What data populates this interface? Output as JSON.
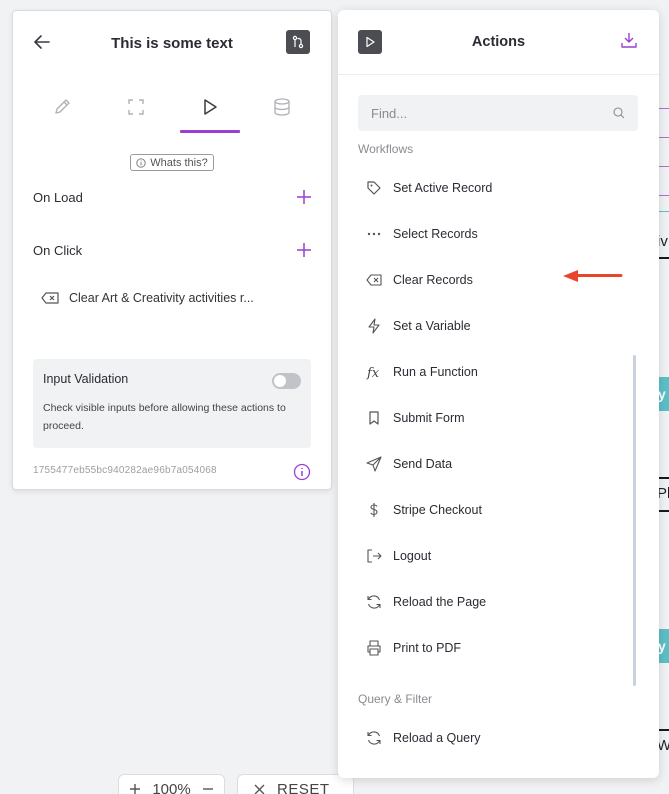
{
  "props": {
    "title": "This is some text",
    "whats_this": "Whats this?",
    "on_load": "On Load",
    "on_click": "On Click",
    "action_item": "Clear Art & Creativity activities r...",
    "validation_title": "Input Validation",
    "validation_desc": "Check visible inputs before allowing these actions to proceed.",
    "validation_enabled": false,
    "element_id": "1755477eb55bc940282ae96b7a054068",
    "tabs": [
      "pencil-icon",
      "expand-icon",
      "play-icon",
      "database-icon"
    ],
    "active_tab": 2
  },
  "actions": {
    "title": "Actions",
    "search_placeholder": "Find...",
    "workflows_label": "Workflows",
    "workflows": [
      {
        "label": "Set Active Record",
        "icon": "tag-icon"
      },
      {
        "label": "Select Records",
        "icon": "dots-icon"
      },
      {
        "label": "Clear Records",
        "icon": "backspace-icon"
      },
      {
        "label": "Set a Variable",
        "icon": "bolt-icon"
      },
      {
        "label": "Run a Function",
        "icon": "function-icon"
      },
      {
        "label": "Submit Form",
        "icon": "bookmark-icon"
      },
      {
        "label": "Send Data",
        "icon": "send-icon"
      },
      {
        "label": "Stripe Checkout",
        "icon": "dollar-icon"
      },
      {
        "label": "Logout",
        "icon": "logout-icon"
      },
      {
        "label": "Reload the Page",
        "icon": "refresh-icon"
      },
      {
        "label": "Print to PDF",
        "icon": "printer-icon"
      }
    ],
    "query_label": "Query & Filter",
    "query_items": [
      {
        "label": "Reload a Query",
        "icon": "refresh-icon"
      }
    ]
  },
  "canvas": {
    "zoom": "100%",
    "reset": "RESET",
    "partial_texts": [
      "iv",
      "Pl",
      "W"
    ],
    "partial_badges": [
      "y",
      "y"
    ]
  },
  "colors": {
    "accent": "#9b3fd0",
    "arrow": "#e8452c",
    "teal": "#5cbfc8"
  }
}
